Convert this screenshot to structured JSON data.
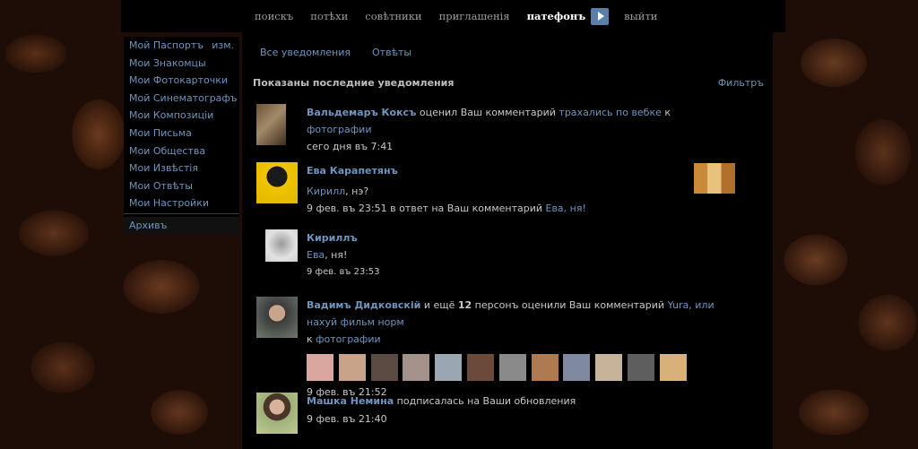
{
  "top_nav": {
    "items": [
      "поискъ",
      "потѣхи",
      "совѣтники",
      "приглашенія",
      "патефонъ",
      "выйти"
    ],
    "active": "патефонъ"
  },
  "side_menu": {
    "edit_label": "изм.",
    "items": [
      "Мой Паспортъ",
      "Мои Знакомцы",
      "Мои Фотокарточки",
      "Мой Синематографъ",
      "Мои Композиціи",
      "Мои Письма",
      "Мои Общества",
      "Мои Извѣстія",
      "Мои Отвѣты",
      "Мои Настройки"
    ],
    "archive": "Архивъ"
  },
  "tabs": [
    "Все уведомления",
    "Отвѣты"
  ],
  "heading": "Показаны последние уведомления",
  "filter_label": "Фильтръ",
  "notifications": [
    {
      "name": "Вальдемаръ Коксъ",
      "action": " оценил Ваш комментарий ",
      "target": "трахались по вебке",
      "joiner": " к ",
      "object": "фотографии",
      "time": "сего дня въ 7:41"
    },
    {
      "name": "Ева Карапетянъ",
      "text_link": "Кирилл",
      "text_rest": ", нэ?",
      "time": "9 фев. въ 23:51 в ответ на Ваш комментарий ",
      "reply_link": "Ева, ня!"
    },
    {
      "name": "Кириллъ",
      "text_link": "Ева",
      "text_rest": ", ня!",
      "time": "9 фев. въ 23:53"
    },
    {
      "name": "Вадимъ Дидковскій",
      "action_pre": " и ещё ",
      "count": "12",
      "action": " персонъ оценили Ваш комментарий ",
      "target": "Yura, или нахуй фильм норм",
      "joiner": "к ",
      "object": "фотографии",
      "time": "9 фев. въ 21:52"
    },
    {
      "name": "Машка Немина",
      "action": " подписалась на Ваши обновления",
      "time": "9 фев. въ 21:40"
    }
  ],
  "colors": {
    "link": "#6f94bf",
    "page_bg": "#000000",
    "accent_button": "#5a7fa8"
  }
}
